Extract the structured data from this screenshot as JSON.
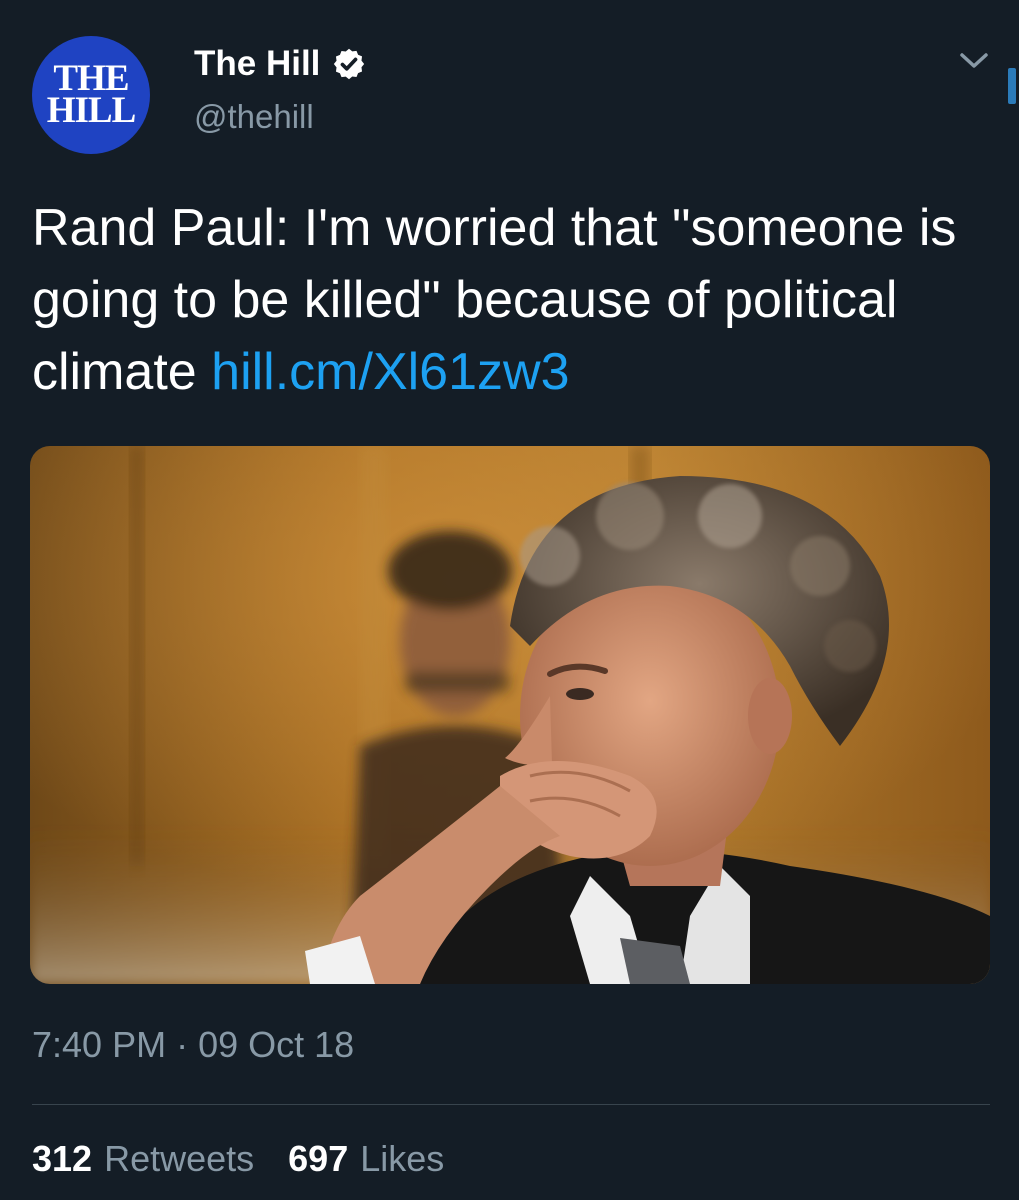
{
  "author": {
    "avatar_logo_line1": "THE",
    "avatar_logo_line2": "HILL",
    "display_name": "The Hill",
    "handle": "@thehill",
    "verified_icon": "verified-badge-icon"
  },
  "menu": {
    "chevron_icon": "chevron-down-icon"
  },
  "tweet": {
    "text": "Rand Paul: I'm worried that \"someone is going to be killed\" because of political climate ",
    "link": "hill.cm/Xl61zw3"
  },
  "media": {
    "description_icon": "photo"
  },
  "meta": {
    "time": "7:40 PM",
    "separator": "·",
    "date": "09 Oct 18"
  },
  "stats": {
    "retweets_count": "312",
    "retweets_label": "Retweets",
    "likes_count": "697",
    "likes_label": "Likes"
  },
  "colors": {
    "background": "#141d26",
    "link": "#1da1f2",
    "secondary_text": "#8899a6",
    "avatar_bg": "#1f43c2"
  }
}
